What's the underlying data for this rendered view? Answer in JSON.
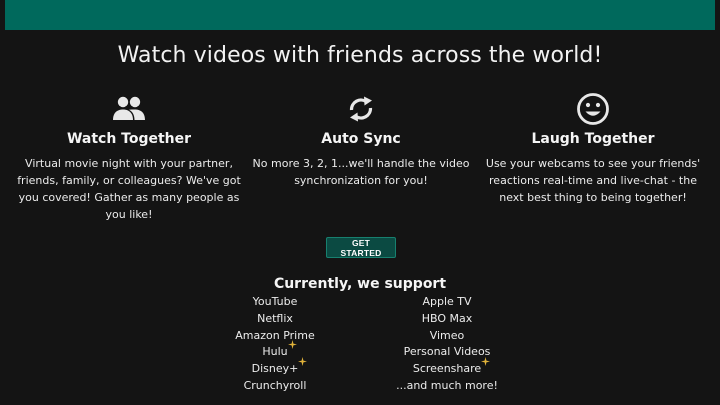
{
  "colors": {
    "banner": "#00695c",
    "background": "#141414",
    "button": "#0b4a42",
    "sparkle": "#e0b23a"
  },
  "headline": "Watch videos with friends across the world!",
  "features": [
    {
      "icon": "group-icon",
      "title": "Watch Together",
      "text": "Virtual movie night with your partner, friends, family, or colleagues? We've got you covered! Gather as many people as you like!"
    },
    {
      "icon": "sync-icon",
      "title": "Auto Sync",
      "text": "No more 3, 2, 1...we'll handle the video synchronization for you!"
    },
    {
      "icon": "smiley-icon",
      "title": "Laugh Together",
      "text": "Use your webcams to see your friends' reactions real-time and live-chat - the next best thing to being together!"
    }
  ],
  "cta": {
    "label": "GET STARTED"
  },
  "support": {
    "title": "Currently, we support",
    "left": [
      {
        "name": "YouTube",
        "new": false
      },
      {
        "name": "Netflix",
        "new": false
      },
      {
        "name": "Amazon Prime",
        "new": false
      },
      {
        "name": "Hulu",
        "new": true
      },
      {
        "name": "Disney+",
        "new": true
      },
      {
        "name": "Crunchyroll",
        "new": false
      }
    ],
    "right": [
      {
        "name": "Apple TV",
        "new": false
      },
      {
        "name": "HBO Max",
        "new": false
      },
      {
        "name": "Vimeo",
        "new": false
      },
      {
        "name": "Personal Videos",
        "new": false
      },
      {
        "name": "Screenshare",
        "new": true
      },
      {
        "name": "...and much more!",
        "new": false
      }
    ]
  }
}
